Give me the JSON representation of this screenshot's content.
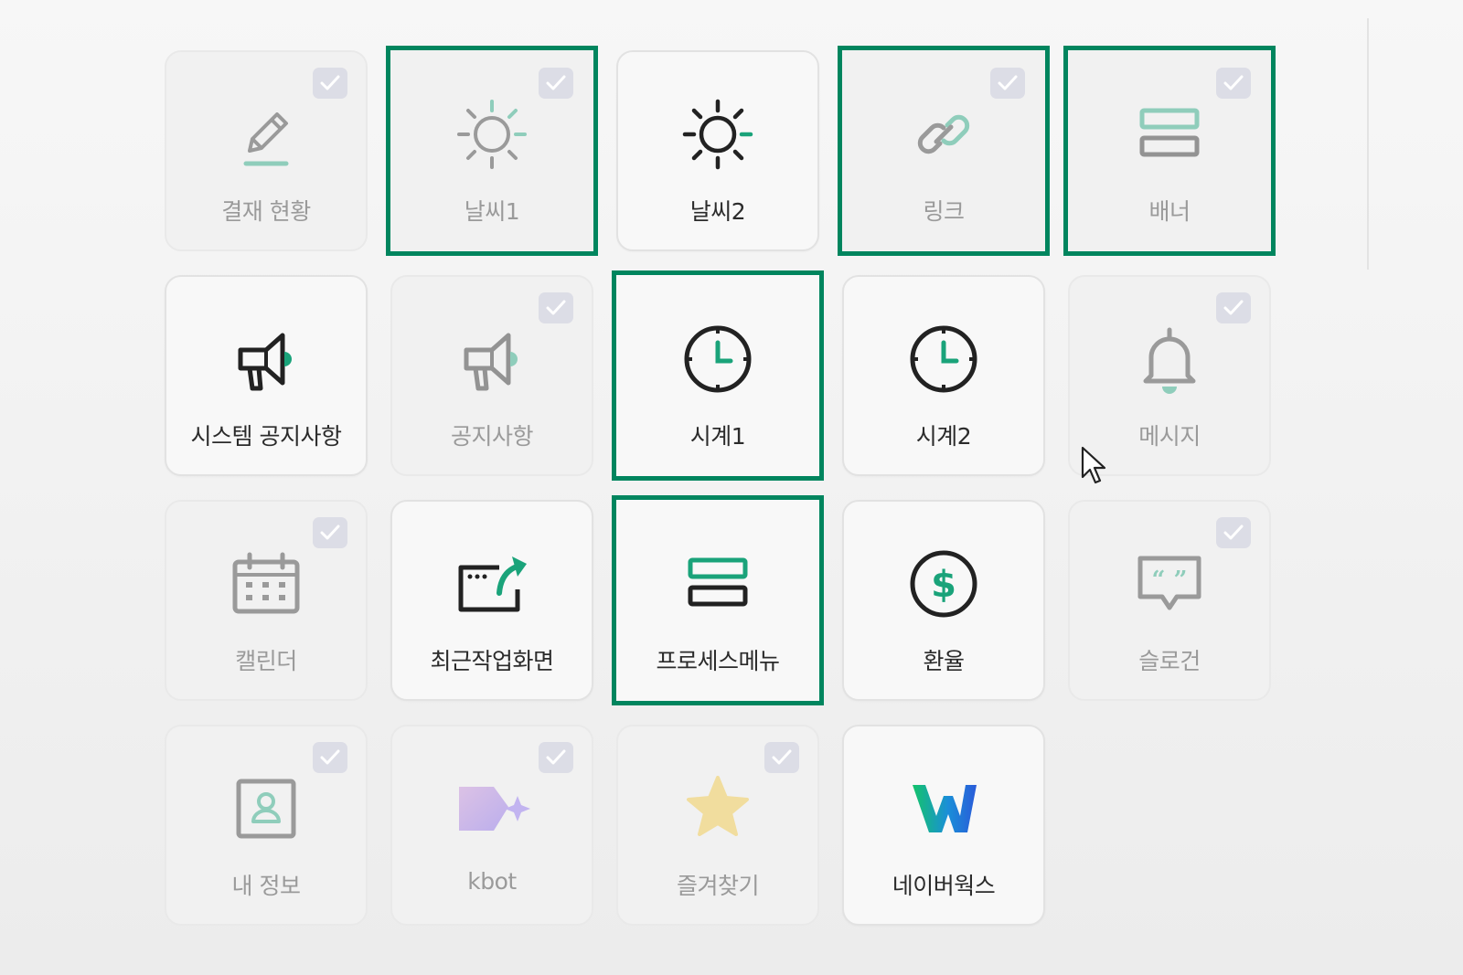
{
  "tiles": [
    {
      "label": "결재 현황",
      "icon": "pencil-icon",
      "selected": true,
      "highlighted": false
    },
    {
      "label": "날씨1",
      "icon": "sun-dashed-icon",
      "selected": true,
      "highlighted": true
    },
    {
      "label": "날씨2",
      "icon": "sun-icon",
      "selected": false,
      "highlighted": false
    },
    {
      "label": "링크",
      "icon": "link-icon",
      "selected": true,
      "highlighted": true
    },
    {
      "label": "배너",
      "icon": "banner-icon",
      "selected": true,
      "highlighted": true
    },
    {
      "label": "시스템 공지사항",
      "icon": "megaphone-icon",
      "selected": false,
      "highlighted": false
    },
    {
      "label": "공지사항",
      "icon": "megaphone-icon",
      "selected": true,
      "highlighted": false
    },
    {
      "label": "시계1",
      "icon": "clock-icon",
      "selected": false,
      "highlighted": true
    },
    {
      "label": "시계2",
      "icon": "clock-icon",
      "selected": false,
      "highlighted": false
    },
    {
      "label": "메시지",
      "icon": "bell-icon",
      "selected": true,
      "highlighted": false
    },
    {
      "label": "캘린더",
      "icon": "calendar-icon",
      "selected": true,
      "highlighted": false
    },
    {
      "label": "최근작업화면",
      "icon": "recent-screen-icon",
      "selected": false,
      "highlighted": false
    },
    {
      "label": "프로세스메뉴",
      "icon": "process-menu-icon",
      "selected": false,
      "highlighted": true
    },
    {
      "label": "환율",
      "icon": "dollar-icon",
      "selected": false,
      "highlighted": false
    },
    {
      "label": "슬로건",
      "icon": "quote-bubble-icon",
      "selected": true,
      "highlighted": false
    },
    {
      "label": "내 정보",
      "icon": "profile-icon",
      "selected": true,
      "highlighted": false
    },
    {
      "label": "kbot",
      "icon": "kbot-icon",
      "selected": true,
      "highlighted": false
    },
    {
      "label": "즐겨찾기",
      "icon": "star-icon",
      "selected": true,
      "highlighted": false
    },
    {
      "label": "네이버웍스",
      "icon": "naverworks-icon",
      "selected": false,
      "highlighted": false
    }
  ],
  "colors": {
    "highlight": "#00855e",
    "accent": "#1aa37a",
    "check_bg": "#dcdde6"
  }
}
